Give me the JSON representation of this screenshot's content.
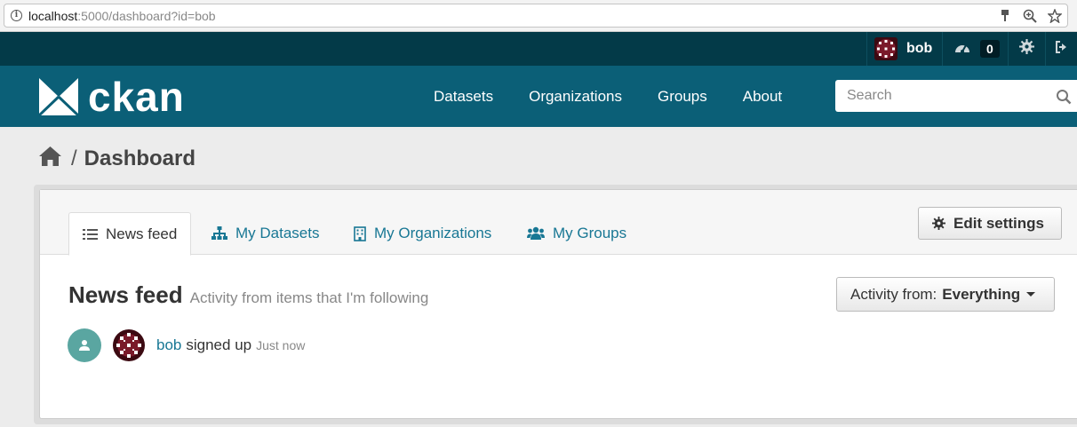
{
  "browser": {
    "url_host": "localhost",
    "url_rest": ":5000/dashboard?id=bob"
  },
  "account": {
    "username": "bob",
    "dashboard_count": "0"
  },
  "masthead": {
    "logo_text": "ckan",
    "nav": [
      "Datasets",
      "Organizations",
      "Groups",
      "About"
    ],
    "search_placeholder": "Search"
  },
  "breadcrumb": {
    "separator": "/",
    "current": "Dashboard"
  },
  "tabs": [
    {
      "label": "News feed",
      "icon": "list-icon",
      "active": true
    },
    {
      "label": "My Datasets",
      "icon": "sitemap-icon",
      "active": false
    },
    {
      "label": "My Organizations",
      "icon": "building-icon",
      "active": false
    },
    {
      "label": "My Groups",
      "icon": "users-icon",
      "active": false
    }
  ],
  "edit_settings_label": "Edit settings",
  "feed": {
    "title": "News feed",
    "subtitle": "Activity from items that I'm following",
    "filter_label": "Activity from:",
    "filter_value": "Everything"
  },
  "activity": {
    "user": "bob",
    "action": "signed up",
    "time": "Just now"
  },
  "colors": {
    "account_bar": "#033a48",
    "masthead": "#0b5f77",
    "link": "#187794",
    "activity_icon": "#5aa6a1"
  }
}
